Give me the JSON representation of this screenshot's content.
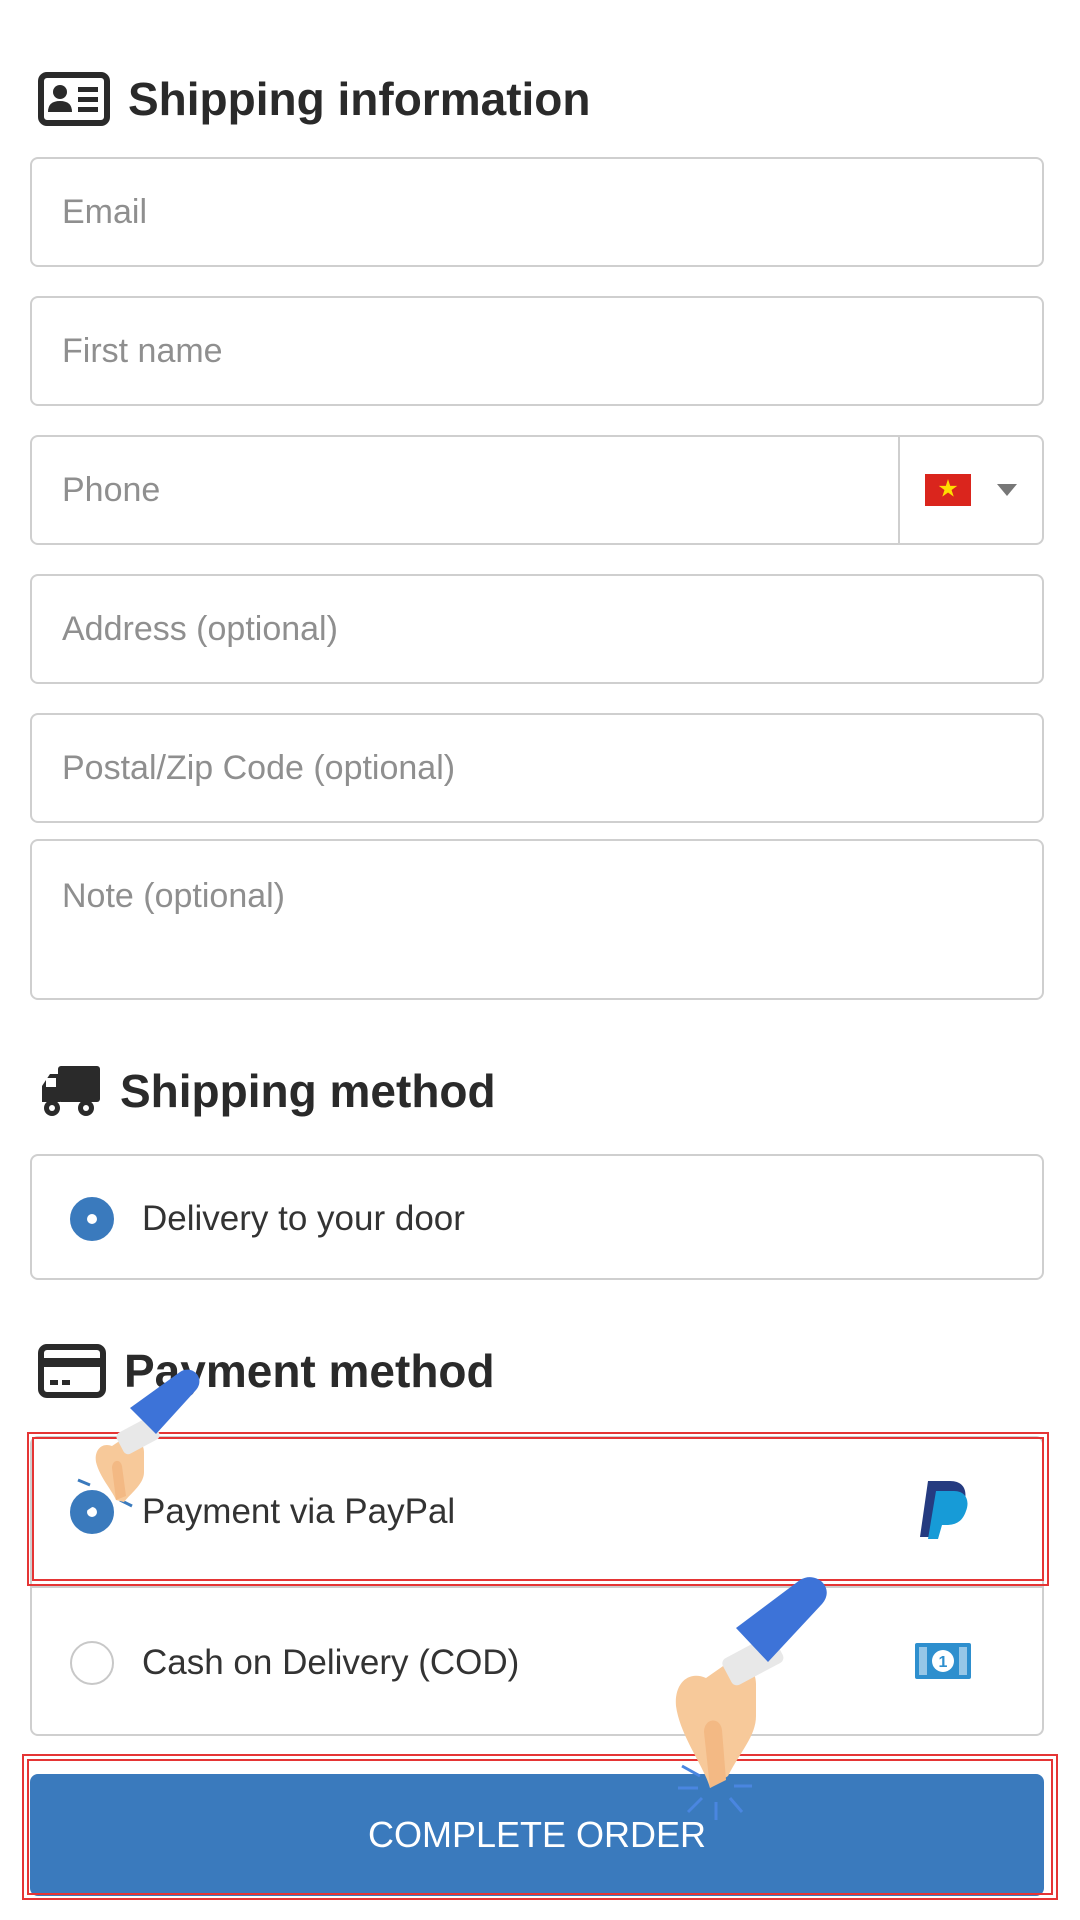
{
  "shipping_info": {
    "title": "Shipping information",
    "title_icon": "id-card-icon",
    "fields": {
      "email_placeholder": "Email",
      "first_name_placeholder": "First name",
      "phone_placeholder": "Phone",
      "address_placeholder": "Address (optional)",
      "postal_placeholder": "Postal/Zip Code (optional)",
      "note_placeholder": "Note (optional)"
    },
    "country_flag": "vietnam-flag-icon"
  },
  "shipping_method": {
    "title": "Shipping method",
    "title_icon": "truck-icon",
    "options": [
      {
        "label": "Delivery to your door",
        "selected": true
      }
    ]
  },
  "payment_method": {
    "title": "Payment method",
    "title_icon": "credit-card-icon",
    "options": [
      {
        "label": "Payment via PayPal",
        "selected": true,
        "icon": "paypal-icon"
      },
      {
        "label": "Cash on Delivery (COD)",
        "selected": false,
        "icon": "cash-icon"
      }
    ]
  },
  "actions": {
    "complete_order": "COMPLETE ORDER"
  },
  "colors": {
    "accent": "#3a7abd",
    "highlight": "#e53535",
    "border": "#cfcfcf"
  }
}
